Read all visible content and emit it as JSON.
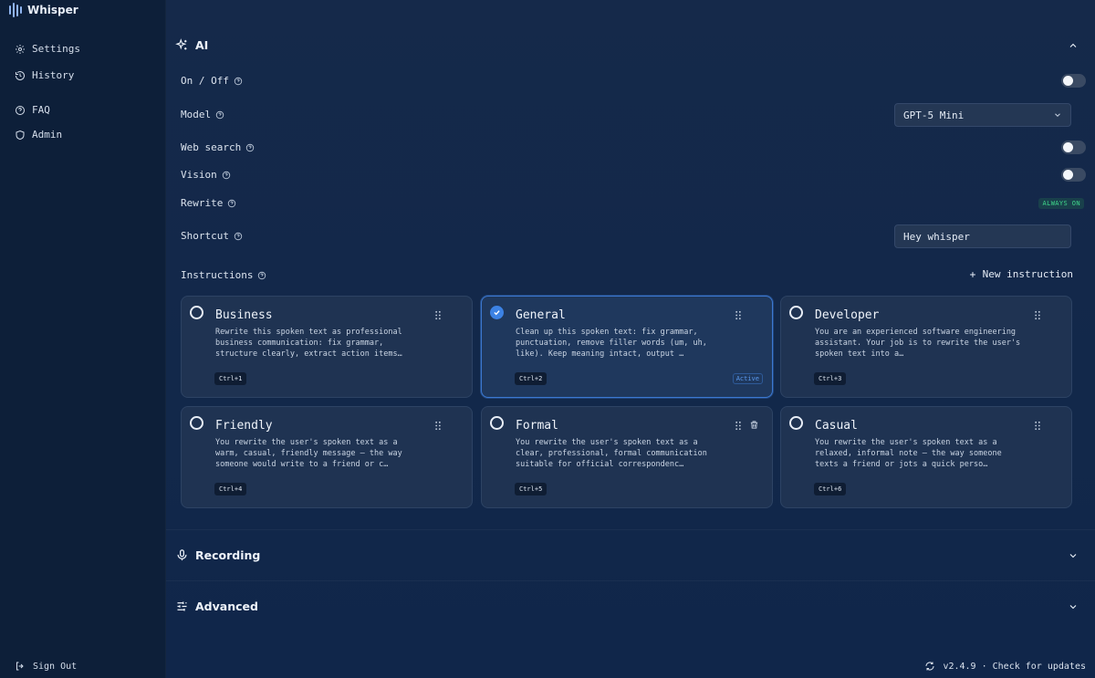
{
  "app": {
    "name": "Whisper"
  },
  "sidebar": {
    "items": [
      {
        "label": "Settings",
        "icon": "gear-icon"
      },
      {
        "label": "History",
        "icon": "history-icon"
      },
      {
        "label": "FAQ",
        "icon": "help-circle-icon"
      },
      {
        "label": "Admin",
        "icon": "shield-icon"
      }
    ],
    "sign_out": "Sign Out"
  },
  "sections": {
    "ai": {
      "title": "AI"
    },
    "recording": {
      "title": "Recording"
    },
    "advanced": {
      "title": "Advanced"
    }
  },
  "settings": {
    "on_off": {
      "label": "On / Off",
      "enabled": false
    },
    "model": {
      "label": "Model",
      "value": "GPT-5 Mini"
    },
    "web_search": {
      "label": "Web search",
      "enabled": false
    },
    "vision": {
      "label": "Vision",
      "enabled": false
    },
    "rewrite": {
      "label": "Rewrite",
      "badge": "ALWAYS ON"
    },
    "shortcut": {
      "label": "Shortcut",
      "value": "Hey whisper"
    },
    "instructions": {
      "label": "Instructions",
      "new_label": "New instruction"
    }
  },
  "instructions": [
    {
      "title": "Business",
      "desc": "Rewrite this spoken text as professional business communication: fix grammar, structure clearly, extract action items…",
      "shortcut": "Ctrl+1",
      "active": false
    },
    {
      "title": "General",
      "desc": "Clean up this spoken text: fix grammar, punctuation, remove filler words (um, uh, like). Keep meaning intact, output …",
      "shortcut": "Ctrl+2",
      "active": true,
      "badge": "Active"
    },
    {
      "title": "Developer",
      "desc": "You are an experienced software engineering assistant. Your job is to rewrite the user's spoken text into a…",
      "shortcut": "Ctrl+3",
      "active": false
    },
    {
      "title": "Friendly",
      "desc": "You rewrite the user's spoken text as a warm, casual, friendly message — the way someone would write to a friend or c…",
      "shortcut": "Ctrl+4",
      "active": false
    },
    {
      "title": "Formal",
      "desc": "You rewrite the user's spoken text as a clear, professional, formal communication suitable for official correspondenc…",
      "shortcut": "Ctrl+5",
      "active": false
    },
    {
      "title": "Casual",
      "desc": "You rewrite the user's spoken text as a relaxed, informal note — the way someone texts a friend or jots a quick perso…",
      "shortcut": "Ctrl+6",
      "active": false
    }
  ],
  "footer": {
    "version": "v2.4.9 · Check for updates"
  },
  "colors": {
    "accent": "#3c82e4",
    "success": "#3fd88b",
    "background": "#0f2340"
  }
}
